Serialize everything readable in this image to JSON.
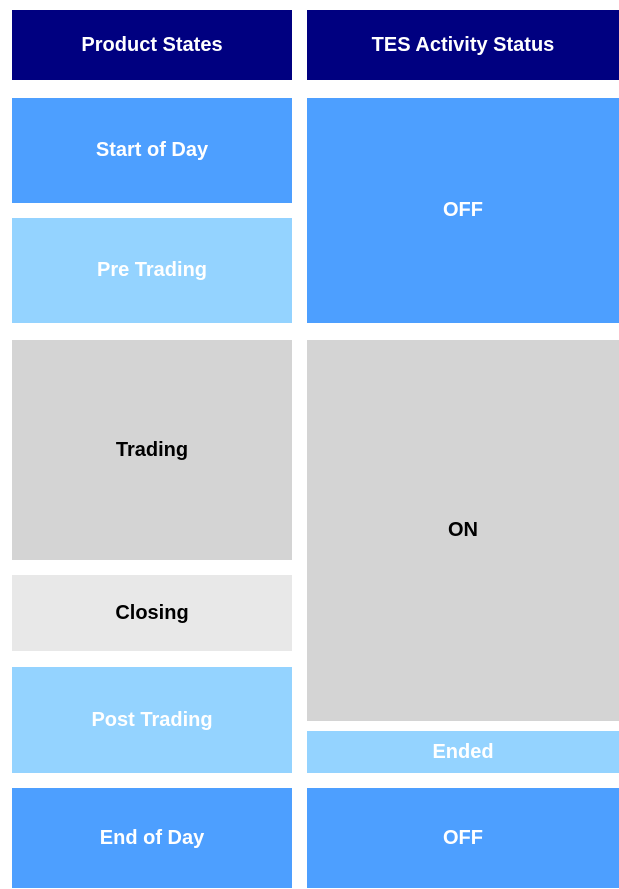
{
  "product_states": {
    "header": "Product States",
    "items": [
      {
        "label": "Start of Day"
      },
      {
        "label": "Pre Trading"
      },
      {
        "label": "Trading"
      },
      {
        "label": "Closing"
      },
      {
        "label": "Post Trading"
      },
      {
        "label": "End of Day"
      }
    ]
  },
  "tes_activity_status": {
    "header": "TES Activity Status",
    "items": [
      {
        "label": "OFF"
      },
      {
        "label": "ON"
      },
      {
        "label": "Ended"
      },
      {
        "label": "OFF"
      }
    ]
  },
  "colors": {
    "header_bg": "#000080",
    "blue": "#4d9fff",
    "light_blue": "#94d3ff",
    "grey": "#d4d4d4",
    "light_grey": "#e8e8e8"
  }
}
